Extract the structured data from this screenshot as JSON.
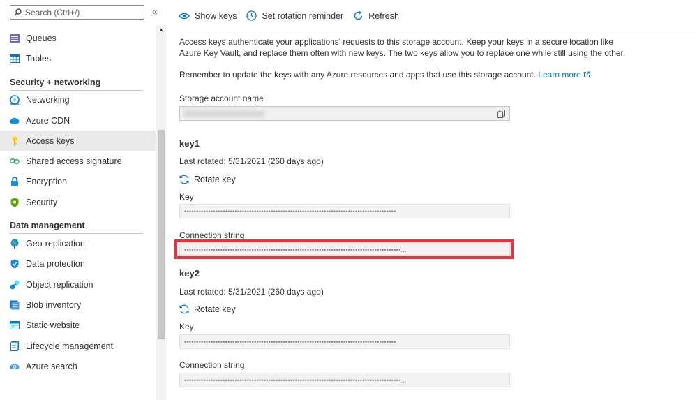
{
  "sidebar": {
    "search_placeholder": "Search (Ctrl+/)",
    "collapse_glyph": "«",
    "items_top": [
      {
        "label": "Queues",
        "icon": "queues-icon"
      },
      {
        "label": "Tables",
        "icon": "tables-icon"
      }
    ],
    "sections": [
      {
        "title": "Security + networking",
        "items": [
          {
            "label": "Networking",
            "icon": "networking-icon"
          },
          {
            "label": "Azure CDN",
            "icon": "cloud-icon"
          },
          {
            "label": "Access keys",
            "icon": "key-icon",
            "selected": true
          },
          {
            "label": "Shared access signature",
            "icon": "link-icon"
          },
          {
            "label": "Encryption",
            "icon": "lock-icon"
          },
          {
            "label": "Security",
            "icon": "shield-icon"
          }
        ]
      },
      {
        "title": "Data management",
        "items": [
          {
            "label": "Geo-replication",
            "icon": "globe-icon"
          },
          {
            "label": "Data protection",
            "icon": "shield-check-icon"
          },
          {
            "label": "Object replication",
            "icon": "replication-icon"
          },
          {
            "label": "Blob inventory",
            "icon": "inventory-icon"
          },
          {
            "label": "Static website",
            "icon": "website-icon"
          },
          {
            "label": "Lifecycle management",
            "icon": "lifecycle-icon"
          },
          {
            "label": "Azure search",
            "icon": "search-cloud-icon"
          }
        ]
      }
    ]
  },
  "toolbar": {
    "show_keys": "Show keys",
    "rotation_reminder": "Set rotation reminder",
    "refresh": "Refresh"
  },
  "main": {
    "intro": "Access keys authenticate your applications' requests to this storage account. Keep your keys in a secure location like Azure Key Vault, and replace them often with new keys. The two keys allow you to replace one while still using the other.",
    "reminder": "Remember to update the keys with any Azure resources and apps that use this storage account.",
    "learn_more": "Learn more",
    "storage_account_label": "Storage account name",
    "key1": {
      "title": "key1",
      "last_rotated": "Last rotated: 5/31/2021 (260 days ago)",
      "rotate_label": "Rotate key",
      "key_label": "Key",
      "key_value": "••••••••••••••••••••••••••••••••••••••••••••••••••••••••••••••••••••••••••••••••••••••••",
      "conn_label": "Connection string",
      "conn_value": "••••••••••••••••••••••••••••••••••••••••••••••••••••••••••••••••••••••••••••••••••••••••••..."
    },
    "key2": {
      "title": "key2",
      "last_rotated": "Last rotated: 5/31/2021 (260 days ago)",
      "rotate_label": "Rotate key",
      "key_label": "Key",
      "key_value": "••••••••••••••••••••••••••••••••••••••••••••••••••••••••••••••••••••••••••••••••••••••••",
      "conn_label": "Connection string",
      "conn_value": "••••••••••••••••••••••••••••••••••••••••••••••••••••••••••••••••••••••••••••••••••••••••••..."
    }
  },
  "colors": {
    "accent": "#0078d4",
    "highlight": "#e8313a",
    "selected_bg": "#edebe9"
  }
}
